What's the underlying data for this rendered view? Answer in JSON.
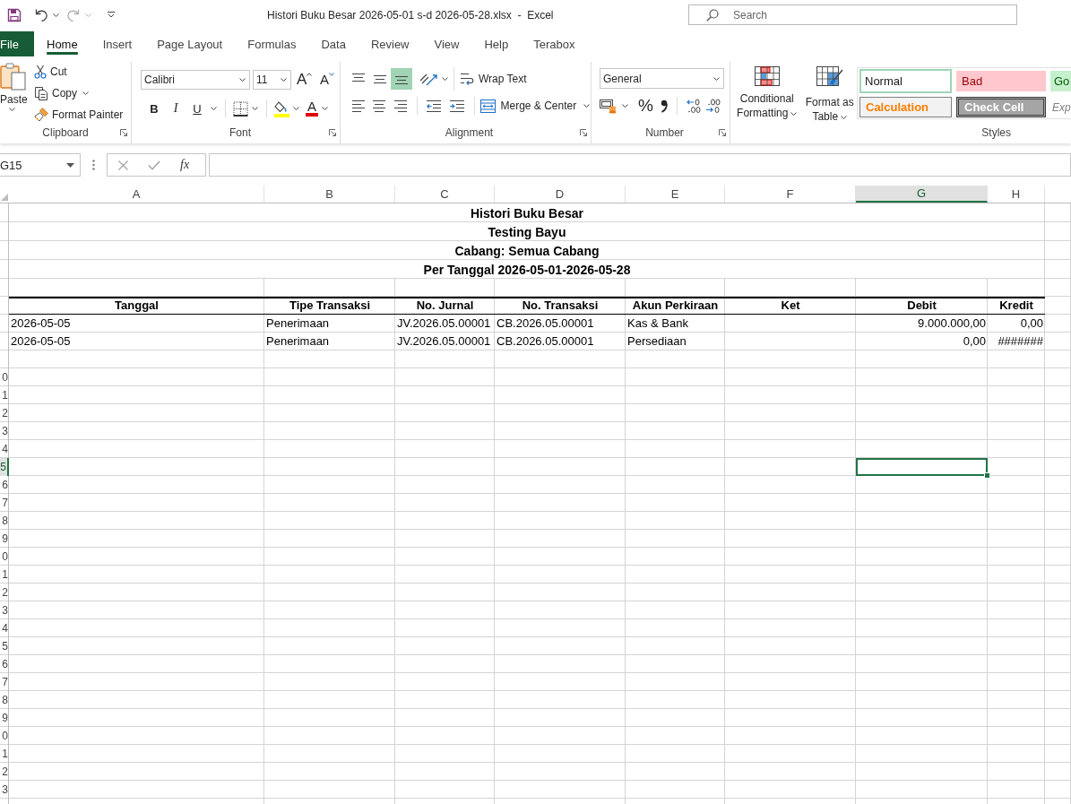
{
  "quick_access": [
    {
      "kind": "save",
      "disabled": false
    },
    {
      "kind": "undo",
      "disabled": false
    },
    {
      "kind": "redo",
      "disabled": true
    },
    {
      "kind": "customize",
      "disabled": false
    }
  ],
  "window": {
    "title": "Histori Buku Besar 2026-05-01 s-d 2026-05-28.xlsx  -  Excel"
  },
  "search": {
    "placeholder": "Search"
  },
  "tabs": [
    {
      "label": "File",
      "kind": "file",
      "selected": false
    },
    {
      "label": "Home",
      "kind": "tab",
      "selected": true
    },
    {
      "label": "Insert",
      "kind": "tab",
      "selected": false
    },
    {
      "label": "Page Layout",
      "kind": "tab",
      "selected": false
    },
    {
      "label": "Formulas",
      "kind": "tab",
      "selected": false
    },
    {
      "label": "Data",
      "kind": "tab",
      "selected": false
    },
    {
      "label": "Review",
      "kind": "tab",
      "selected": false
    },
    {
      "label": "View",
      "kind": "tab",
      "selected": false
    },
    {
      "label": "Help",
      "kind": "tab",
      "selected": false
    },
    {
      "label": "Terabox",
      "kind": "tab",
      "selected": false
    }
  ],
  "ribbon": {
    "clipboard": {
      "label": "Clipboard",
      "paste": "Paste",
      "cut": "Cut",
      "copy": "Copy",
      "format_painter": "Format Painter"
    },
    "font": {
      "label": "Font",
      "font_name": "Calibri",
      "font_size": "11",
      "grow": "A",
      "shrink": "A",
      "bold": "B",
      "italic": "I",
      "underline": "U",
      "font_color": "A"
    },
    "alignment": {
      "label": "Alignment",
      "vertical": [
        {
          "kind": "top",
          "selected": false
        },
        {
          "kind": "middle",
          "selected": false
        },
        {
          "kind": "bottom",
          "selected": true
        }
      ],
      "horizontal": [
        {
          "kind": "left",
          "selected": false
        },
        {
          "kind": "center",
          "selected": false
        },
        {
          "kind": "right",
          "selected": false
        }
      ],
      "wrap_text": "Wrap Text",
      "merge_center": "Merge & Center"
    },
    "number": {
      "label": "Number",
      "format": "General",
      "percent": "%"
    },
    "styles": {
      "label": "Styles",
      "conditional_formatting": "Conditional Formatting",
      "format_as_table": "Format as Table",
      "cell_styles": [
        {
          "label": "Normal",
          "kind": "normal",
          "selected": true
        },
        {
          "label": "Bad",
          "kind": "bad",
          "selected": false
        },
        {
          "label": "Go",
          "kind": "good",
          "selected": false
        },
        {
          "label": "Calculation",
          "kind": "calculation",
          "selected": false
        },
        {
          "label": "Check Cell",
          "kind": "check",
          "selected": false
        },
        {
          "label": "Exp",
          "kind": "explanatory",
          "selected": false
        }
      ]
    }
  },
  "formula_bar": {
    "name_box": "G15",
    "fx": "fx"
  },
  "sheet": {
    "columns": [
      {
        "label": "A",
        "selected": false
      },
      {
        "label": "B",
        "selected": false
      },
      {
        "label": "C",
        "selected": false
      },
      {
        "label": "D",
        "selected": false
      },
      {
        "label": "E",
        "selected": false
      },
      {
        "label": "F",
        "selected": false
      },
      {
        "label": "G",
        "selected": true
      },
      {
        "label": "H",
        "selected": false
      }
    ],
    "rows": [
      {
        "kind": "title",
        "text": "Histori Buku Besar",
        "selected": false
      },
      {
        "kind": "title",
        "text": "Testing Bayu",
        "selected": false
      },
      {
        "kind": "title",
        "text": "Cabang: Semua Cabang",
        "selected": false
      },
      {
        "kind": "title",
        "text": "Per Tanggal 2026-05-01-2026-05-28",
        "selected": false
      },
      {
        "kind": "blank",
        "selected": false
      },
      {
        "kind": "header",
        "selected": false,
        "cells": {
          "a": "Tanggal",
          "b": "Tipe Transaksi",
          "c": "No. Jurnal",
          "d": "No. Transaksi",
          "e": "Akun Perkiraan",
          "f": "Ket",
          "g": "Debit",
          "h": "Kredit"
        }
      },
      {
        "kind": "data",
        "selected": false,
        "cells": {
          "a": "2026-05-05",
          "b": "Penerimaan",
          "c": "JV.2026.05.00001",
          "d": "CB.2026.05.00001",
          "e": "Kas & Bank",
          "g": "9.000.000,00",
          "h": "0,00"
        }
      },
      {
        "kind": "data",
        "selected": false,
        "cells": {
          "a": "2026-05-05",
          "b": "Penerimaan",
          "c": "JV.2026.05.00001",
          "d": "CB.2026.05.00001",
          "e": "Persediaan",
          "g": "0,00",
          "h": "#######"
        }
      },
      {
        "kind": "blank",
        "selected": false
      },
      {
        "kind": "blank",
        "header": "0",
        "selected": false
      },
      {
        "kind": "blank",
        "header": "1",
        "selected": false
      },
      {
        "kind": "blank",
        "header": "2",
        "selected": false
      },
      {
        "kind": "blank",
        "header": "3",
        "selected": false
      },
      {
        "kind": "blank",
        "header": "4",
        "selected": false
      },
      {
        "kind": "blank",
        "header": "5",
        "selected": true
      },
      {
        "kind": "blank",
        "header": "6",
        "selected": false
      },
      {
        "kind": "blank",
        "header": "7",
        "selected": false
      },
      {
        "kind": "blank",
        "header": "8",
        "selected": false
      },
      {
        "kind": "blank",
        "header": "9",
        "selected": false
      },
      {
        "kind": "blank",
        "header": "0",
        "selected": false
      },
      {
        "kind": "blank",
        "header": "1",
        "selected": false
      },
      {
        "kind": "blank",
        "header": "2",
        "selected": false
      },
      {
        "kind": "blank",
        "header": "3",
        "selected": false
      },
      {
        "kind": "blank",
        "header": "4",
        "selected": false
      },
      {
        "kind": "blank",
        "header": "5",
        "selected": false
      },
      {
        "kind": "blank",
        "header": "6",
        "selected": false
      },
      {
        "kind": "blank",
        "header": "7",
        "selected": false
      },
      {
        "kind": "blank",
        "header": "8",
        "selected": false
      },
      {
        "kind": "blank",
        "header": "9",
        "selected": false
      },
      {
        "kind": "blank",
        "header": "0",
        "selected": false
      },
      {
        "kind": "blank",
        "header": "1",
        "selected": false
      },
      {
        "kind": "blank",
        "header": "2",
        "selected": false
      },
      {
        "kind": "blank",
        "header": "3",
        "selected": false
      }
    ]
  }
}
